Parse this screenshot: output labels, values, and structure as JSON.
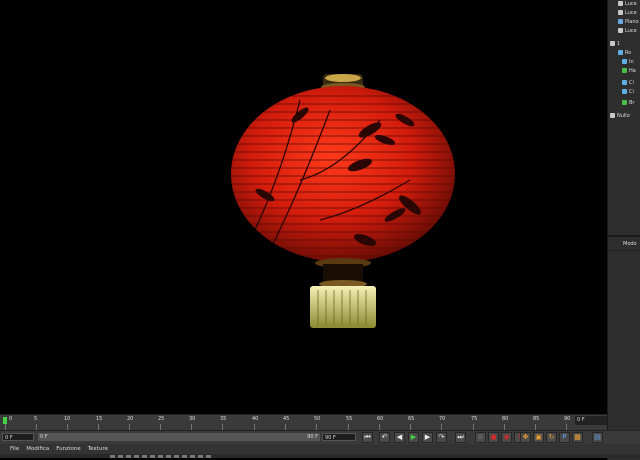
{
  "object_manager": {
    "items": [
      {
        "label": "Luce",
        "icon_color": "#c9c9c9"
      },
      {
        "label": "Luce",
        "icon_color": "#c9c9c9"
      },
      {
        "label": "Piano",
        "icon_color": "#6aa9e0"
      },
      {
        "label": "Luce",
        "icon_color": "#c9c9c9"
      },
      {
        "label": "1",
        "icon_color": "#c9c9c9"
      },
      {
        "label": "Ro",
        "icon_color": "#5fb0e8"
      },
      {
        "label": "In",
        "icon_color": "#5fb0e8"
      },
      {
        "label": "Ha",
        "icon_color": "#48c048"
      },
      {
        "label": "Ci",
        "icon_color": "#5fb0e8"
      },
      {
        "label": "Ci",
        "icon_color": "#5fb0e8"
      },
      {
        "label": "Br",
        "icon_color": "#48c048"
      },
      {
        "label": "Nullo",
        "icon_color": "#c9c9c9"
      }
    ]
  },
  "attribute_manager": {
    "mode_label": "Modo"
  },
  "timeline": {
    "ticks": [
      "0",
      "5",
      "10",
      "15",
      "20",
      "25",
      "30",
      "35",
      "40",
      "45",
      "50",
      "55",
      "60",
      "65",
      "70",
      "75",
      "80",
      "85",
      "90"
    ],
    "current_frame": "0 F"
  },
  "transport": {
    "start_frame": "0 F",
    "current_field": "0 F",
    "end_inner": "90 F",
    "end_frame": "90 F",
    "buttons": [
      {
        "name": "goto-start-button",
        "glyph": "⏮"
      },
      {
        "name": "prev-key-button",
        "glyph": "↶"
      },
      {
        "name": "prev-frame-button",
        "glyph": "◀"
      },
      {
        "name": "play-button",
        "glyph": "▶"
      },
      {
        "name": "next-frame-button",
        "glyph": "▶"
      },
      {
        "name": "next-key-button",
        "glyph": "↷"
      },
      {
        "name": "goto-end-button",
        "glyph": "⏭"
      }
    ],
    "record_buttons": [
      {
        "name": "record-disabled-button",
        "glyph": "⊘",
        "color": "#777777"
      },
      {
        "name": "record-button",
        "glyph": "●",
        "color": "#d02a2a"
      },
      {
        "name": "autokey-button",
        "glyph": "◉",
        "color": "#d02a2a"
      },
      {
        "name": "keyframe-selection-button",
        "glyph": "?",
        "color": "#d02a2a"
      }
    ],
    "key_buttons": [
      {
        "name": "key-position-button",
        "glyph": "✥",
        "color": "#f0a030"
      },
      {
        "name": "key-scale-button",
        "glyph": "▣",
        "color": "#f0a030"
      },
      {
        "name": "key-rotation-button",
        "glyph": "↻",
        "color": "#f0a030"
      },
      {
        "name": "key-param-button",
        "glyph": "P",
        "color": "#5fa0e0"
      },
      {
        "name": "key-pla-button",
        "glyph": "▦",
        "color": "#f0a030"
      },
      {
        "name": "timeline-window-button",
        "glyph": "▤",
        "color": "#5fa0e0"
      }
    ]
  },
  "material_menu": {
    "items": [
      "File",
      "Modifica",
      "Funzione",
      "Texture"
    ]
  },
  "colors": {
    "lantern_red": "#d41c0c",
    "lantern_gold": "#c9a64a",
    "tassel": "#e8e6a0"
  }
}
